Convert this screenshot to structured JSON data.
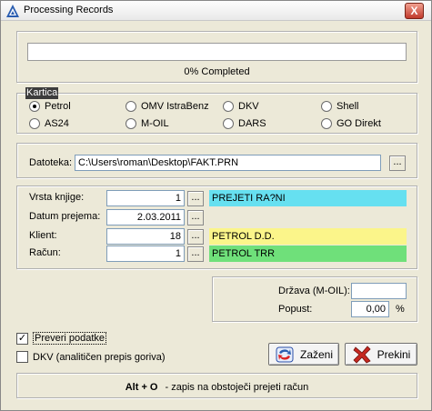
{
  "window": {
    "title": "Processing Records",
    "close_label": "X"
  },
  "progress": {
    "percent": 0,
    "text": "0% Completed"
  },
  "kartica": {
    "legend": "Kartica",
    "options": [
      {
        "label": "Petrol",
        "selected": true
      },
      {
        "label": "OMV IstraBenz",
        "selected": false
      },
      {
        "label": "DKV",
        "selected": false
      },
      {
        "label": "Shell",
        "selected": false
      },
      {
        "label": "AS24",
        "selected": false
      },
      {
        "label": "M-OIL",
        "selected": false
      },
      {
        "label": "DARS",
        "selected": false
      },
      {
        "label": "GO Direkt",
        "selected": false
      }
    ]
  },
  "datoteka": {
    "label": "Datoteka:",
    "value": "C:\\Users\\roman\\Desktop\\FAKT.PRN",
    "browse": "..."
  },
  "records": {
    "vrsta": {
      "label": "Vrsta knjige:",
      "value": "1",
      "info": "PREJETI RA?NI",
      "info_color": "#66e0f0"
    },
    "datum": {
      "label": "Datum prejema:",
      "value": "2.03.2011"
    },
    "klient": {
      "label": "Klient:",
      "value": "18",
      "info": "PETROL D.D.",
      "info_color": "#fbf58a"
    },
    "racun": {
      "label": "Račun:",
      "value": "1",
      "info": "PETROL TRR",
      "info_color": "#6fe07a"
    },
    "browse": "..."
  },
  "moil": {
    "drzava_label": "Država (M-OIL):",
    "drzava_value": "",
    "popust_label": "Popust:",
    "popust_value": "0,00",
    "percent_sign": "%"
  },
  "checks": [
    {
      "label": "Preveri podatke",
      "checked": true
    },
    {
      "label": "DKV (analitičen prepis goriva)",
      "checked": false
    }
  ],
  "buttons": {
    "start": "Zaženi",
    "cancel": "Prekini"
  },
  "hint": {
    "key": "Alt + O",
    "text": "- zapis na obstoječi prejeti račun"
  }
}
